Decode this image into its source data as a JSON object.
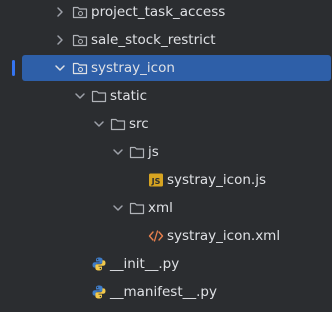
{
  "tree": {
    "items": [
      {
        "label": "project_task_access",
        "icon": "module-folder-icon",
        "expanded": false
      },
      {
        "label": "sale_stock_restrict",
        "icon": "module-folder-icon",
        "expanded": false
      },
      {
        "label": "systray_icon",
        "icon": "module-folder-icon",
        "expanded": true,
        "selected": true
      },
      {
        "label": "static",
        "icon": "folder-icon",
        "expanded": true
      },
      {
        "label": "src",
        "icon": "folder-icon",
        "expanded": true
      },
      {
        "label": "js",
        "icon": "folder-icon",
        "expanded": true
      },
      {
        "label": "systray_icon.js",
        "icon": "js-file-icon"
      },
      {
        "label": "xml",
        "icon": "folder-icon",
        "expanded": true
      },
      {
        "label": "systray_icon.xml",
        "icon": "xml-file-icon"
      },
      {
        "label": "__init__.py",
        "icon": "python-file-icon"
      },
      {
        "label": "__manifest__.py",
        "icon": "python-file-icon"
      }
    ]
  },
  "colors": {
    "background": "#2b2d30",
    "selection": "#2e5fa8",
    "text": "#dfe1e5",
    "js_badge": "#d7a421",
    "xml_icon": "#e8804e",
    "python_blue": "#3f7cc7",
    "python_yellow": "#f2c94c"
  }
}
